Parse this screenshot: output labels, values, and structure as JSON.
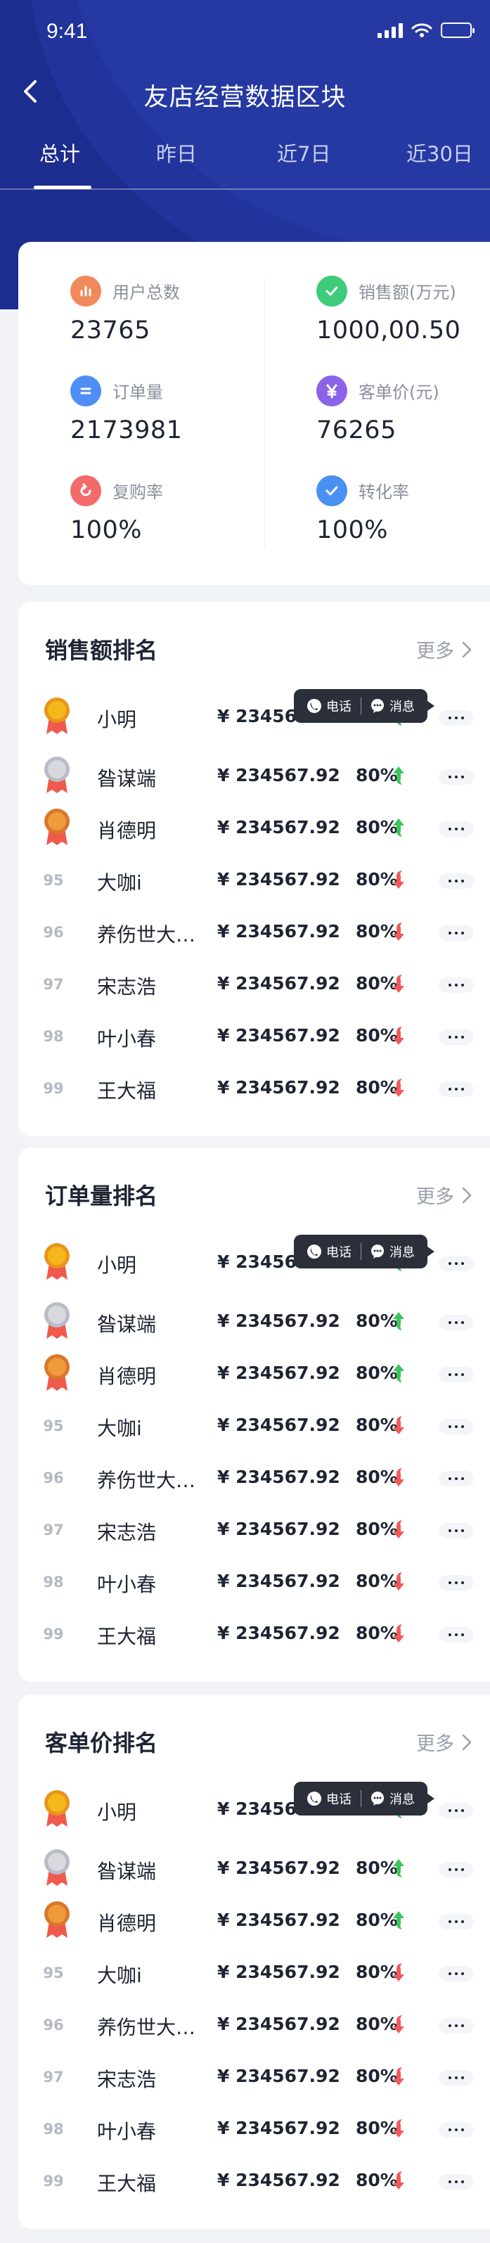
{
  "status_bar": {
    "time": "9:41"
  },
  "nav": {
    "title": "友店经营数据区块"
  },
  "tabs": [
    {
      "label": "总计",
      "active": true
    },
    {
      "label": "昨日",
      "active": false
    },
    {
      "label": "近7日",
      "active": false
    },
    {
      "label": "近30日",
      "active": false
    }
  ],
  "summary": {
    "metrics": [
      {
        "label": "用户总数",
        "value": "23765",
        "icon": "bar-chart-icon",
        "color": "#f08a5d"
      },
      {
        "label": "销售额(万元)",
        "value": "1000,00.50",
        "icon": "check-icon",
        "color": "#3ecb7a"
      },
      {
        "label": "订单量",
        "value": "2173981",
        "icon": "equals-icon",
        "color": "#4f8ef5"
      },
      {
        "label": "客单价(元)",
        "value": "76265",
        "icon": "yen-icon",
        "color": "#8a63e8"
      },
      {
        "label": "复购率",
        "value": "100%",
        "icon": "refresh-icon",
        "color": "#f26a6a"
      },
      {
        "label": "转化率",
        "value": "100%",
        "icon": "check-icon",
        "color": "#4a90f0"
      }
    ]
  },
  "popover": {
    "phone_label": "电话",
    "message_label": "消息"
  },
  "colors": {
    "up": "#3ec45a",
    "down": "#ef5a5a"
  },
  "rankings": [
    {
      "title": "销售额排名",
      "more_label": "更多",
      "rows": [
        {
          "rank": "1",
          "medal": "gold",
          "name": "小明",
          "amount": "¥ 234567.92",
          "pct": "80%",
          "trend": "up"
        },
        {
          "rank": "2",
          "medal": "silver",
          "name": "昝谋端",
          "amount": "¥ 234567.92",
          "pct": "80%",
          "trend": "up"
        },
        {
          "rank": "3",
          "medal": "bronze",
          "name": "肖德明",
          "amount": "¥ 234567.92",
          "pct": "80%",
          "trend": "up"
        },
        {
          "rank": "95",
          "medal": "",
          "name": "大咖i",
          "amount": "¥ 234567.92",
          "pct": "80%",
          "trend": "down"
        },
        {
          "rank": "96",
          "medal": "",
          "name": "养伤世大…",
          "amount": "¥ 234567.92",
          "pct": "80%",
          "trend": "down"
        },
        {
          "rank": "97",
          "medal": "",
          "name": "宋志浩",
          "amount": "¥ 234567.92",
          "pct": "80%",
          "trend": "down"
        },
        {
          "rank": "98",
          "medal": "",
          "name": "叶小春",
          "amount": "¥ 234567.92",
          "pct": "80%",
          "trend": "down"
        },
        {
          "rank": "99",
          "medal": "",
          "name": "王大福",
          "amount": "¥ 234567.92",
          "pct": "80%",
          "trend": "down"
        }
      ]
    },
    {
      "title": "订单量排名",
      "more_label": "更多",
      "rows": [
        {
          "rank": "1",
          "medal": "gold",
          "name": "小明",
          "amount": "¥ 234567.92",
          "pct": "80%",
          "trend": "up"
        },
        {
          "rank": "2",
          "medal": "silver",
          "name": "昝谋端",
          "amount": "¥ 234567.92",
          "pct": "80%",
          "trend": "up"
        },
        {
          "rank": "3",
          "medal": "bronze",
          "name": "肖德明",
          "amount": "¥ 234567.92",
          "pct": "80%",
          "trend": "up"
        },
        {
          "rank": "95",
          "medal": "",
          "name": "大咖i",
          "amount": "¥ 234567.92",
          "pct": "80%",
          "trend": "down"
        },
        {
          "rank": "96",
          "medal": "",
          "name": "养伤世大…",
          "amount": "¥ 234567.92",
          "pct": "80%",
          "trend": "down"
        },
        {
          "rank": "97",
          "medal": "",
          "name": "宋志浩",
          "amount": "¥ 234567.92",
          "pct": "80%",
          "trend": "down"
        },
        {
          "rank": "98",
          "medal": "",
          "name": "叶小春",
          "amount": "¥ 234567.92",
          "pct": "80%",
          "trend": "down"
        },
        {
          "rank": "99",
          "medal": "",
          "name": "王大福",
          "amount": "¥ 234567.92",
          "pct": "80%",
          "trend": "down"
        }
      ]
    },
    {
      "title": "客单价排名",
      "more_label": "更多",
      "rows": [
        {
          "rank": "1",
          "medal": "gold",
          "name": "小明",
          "amount": "¥ 234567.92",
          "pct": "80%",
          "trend": "up"
        },
        {
          "rank": "2",
          "medal": "silver",
          "name": "昝谋端",
          "amount": "¥ 234567.92",
          "pct": "80%",
          "trend": "up"
        },
        {
          "rank": "3",
          "medal": "bronze",
          "name": "肖德明",
          "amount": "¥ 234567.92",
          "pct": "80%",
          "trend": "up"
        },
        {
          "rank": "95",
          "medal": "",
          "name": "大咖i",
          "amount": "¥ 234567.92",
          "pct": "80%",
          "trend": "down"
        },
        {
          "rank": "96",
          "medal": "",
          "name": "养伤世大…",
          "amount": "¥ 234567.92",
          "pct": "80%",
          "trend": "down"
        },
        {
          "rank": "97",
          "medal": "",
          "name": "宋志浩",
          "amount": "¥ 234567.92",
          "pct": "80%",
          "trend": "down"
        },
        {
          "rank": "98",
          "medal": "",
          "name": "叶小春",
          "amount": "¥ 234567.92",
          "pct": "80%",
          "trend": "down"
        },
        {
          "rank": "99",
          "medal": "",
          "name": "王大福",
          "amount": "¥ 234567.92",
          "pct": "80%",
          "trend": "down"
        }
      ]
    }
  ]
}
